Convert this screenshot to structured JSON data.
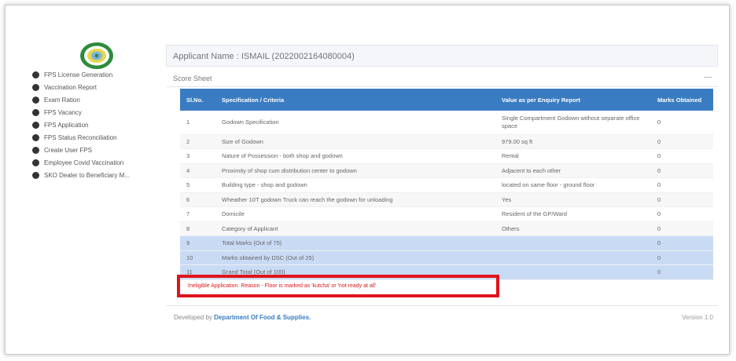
{
  "sidebar": {
    "items": [
      {
        "label": "FPS License Generation"
      },
      {
        "label": "Vaccination Report"
      },
      {
        "label": "Exam Ration"
      },
      {
        "label": "FPS Vacancy"
      },
      {
        "label": "FPS Application"
      },
      {
        "label": "FPS Status Reconciliation"
      },
      {
        "label": "Create User FPS"
      },
      {
        "label": "Employee Covid Vaccination"
      },
      {
        "label": "SKO Dealer to Beneficiary M..."
      }
    ]
  },
  "header": {
    "applicant": "Applicant Name : ISMAIL (2022002164080004)"
  },
  "scoresheet": {
    "title": "Score Sheet",
    "minimize": "—",
    "columns": {
      "sl": "Sl.No.",
      "spec": "Specification / Criteria",
      "value": "Value as per Enquiry Report",
      "marks": "Marks Obtained"
    },
    "rows": [
      {
        "sl": "1",
        "spec": "Godown Specification",
        "value": "Single Compartment Godown without separate office space",
        "marks": "0"
      },
      {
        "sl": "2",
        "spec": "Size of Godown",
        "value": "979.00 sq ft",
        "marks": "0"
      },
      {
        "sl": "3",
        "spec": "Nature of Possession - both shop and godown",
        "value": "Rental",
        "marks": "0"
      },
      {
        "sl": "4",
        "spec": "Proximity of shop cum distribution center to godown",
        "value": "Adjacent to each other",
        "marks": "0"
      },
      {
        "sl": "5",
        "spec": "Building type - shop and godown",
        "value": "located on same floor - ground floor",
        "marks": "0"
      },
      {
        "sl": "6",
        "spec": "Wheather 10T godown Truck can reach the godown for unloading",
        "value": "Yes",
        "marks": "0"
      },
      {
        "sl": "7",
        "spec": "Domicile",
        "value": "Resident of the GP/Ward",
        "marks": "0"
      },
      {
        "sl": "8",
        "spec": "Category of Applicant",
        "value": "Others",
        "marks": "0"
      }
    ],
    "totals": [
      {
        "sl": "9",
        "spec": "Total Marks (Out of 75)",
        "value": "",
        "marks": "0"
      },
      {
        "sl": "10",
        "spec": "Marks obtained by DSC (Out of 25)",
        "value": "",
        "marks": "0"
      },
      {
        "sl": "11",
        "spec": "Grand Total (Out of 100)",
        "value": "",
        "marks": "0"
      }
    ],
    "message": "Ineligible Application. Reason - Floor is marked as 'kutcha' or 'not ready at all'"
  },
  "footer": {
    "prefix": "Developed by ",
    "link": "Department Of Food & Supplies.",
    "version": "Version 1.0"
  },
  "colors": {
    "table_header": "#3a7cc2",
    "total_rows": "#c9dbf4",
    "alert": "#e0141b"
  },
  "icons": [
    "emblem-logo",
    "bullet-dot"
  ]
}
